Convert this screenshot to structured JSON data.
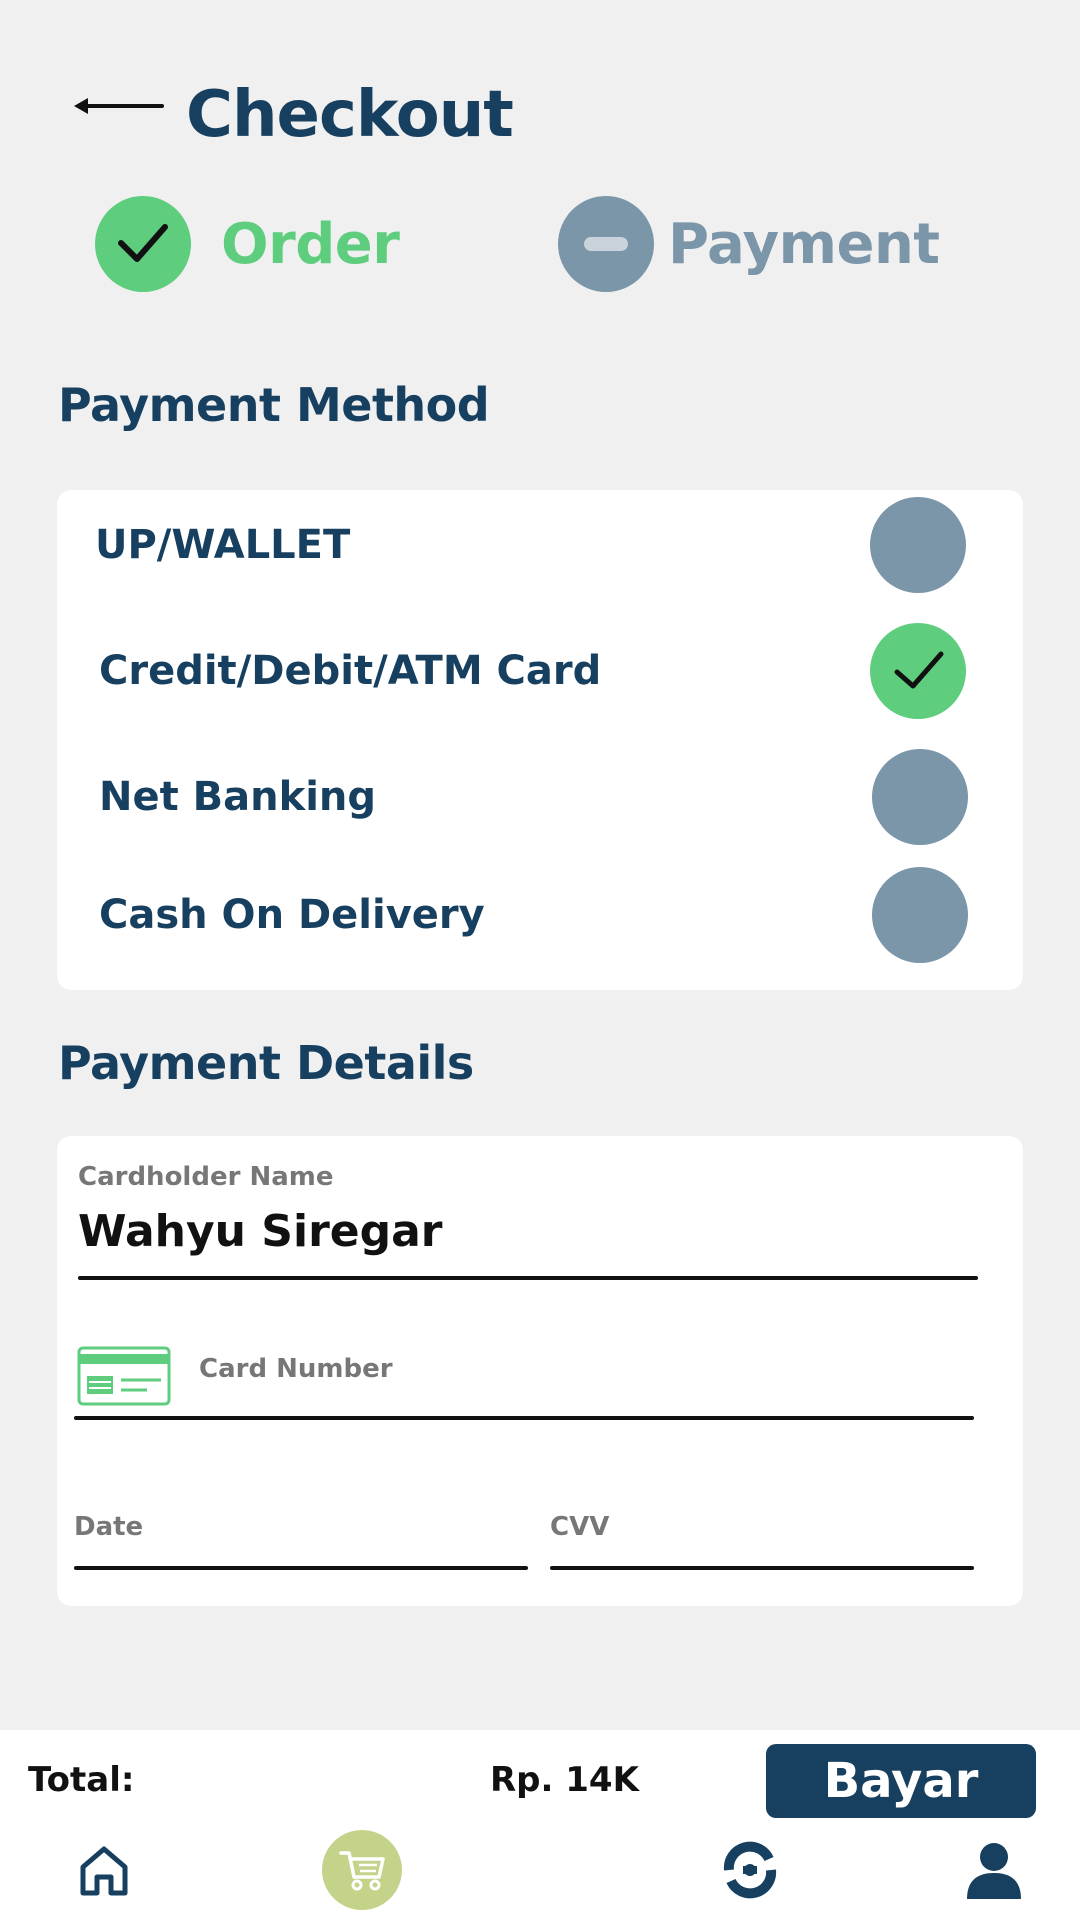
{
  "header": {
    "title": "Checkout"
  },
  "stepper": {
    "steps": [
      {
        "label": "Order",
        "state": "done"
      },
      {
        "label": "Payment",
        "state": "pending"
      }
    ]
  },
  "payment_method": {
    "title": "Payment Method",
    "options": [
      {
        "label": "UP/WALLET",
        "selected": false
      },
      {
        "label": "Credit/Debit/ATM Card",
        "selected": true
      },
      {
        "label": "Net Banking",
        "selected": false
      },
      {
        "label": "Cash On Delivery",
        "selected": false
      }
    ]
  },
  "payment_details": {
    "title": "Payment Details",
    "cardholder_label": "Cardholder Name",
    "cardholder_value": "Wahyu Siregar",
    "card_number_placeholder": "Card Number",
    "date_placeholder": "Date",
    "cvv_placeholder": "CVV"
  },
  "footer": {
    "total_label": "Total:",
    "total_value": "Rp. 14K",
    "pay_label": "Bayar"
  },
  "nav": {
    "items": [
      {
        "icon": "home-icon"
      },
      {
        "icon": "cart-icon",
        "active": true
      },
      {
        "icon": "history-icon"
      },
      {
        "icon": "profile-icon"
      }
    ]
  },
  "colors": {
    "primary": "#173f5f",
    "success": "#5ecd7e",
    "inactive": "#7b95a9",
    "cart_active": "#c3d38a",
    "background": "#f0f0f0"
  }
}
